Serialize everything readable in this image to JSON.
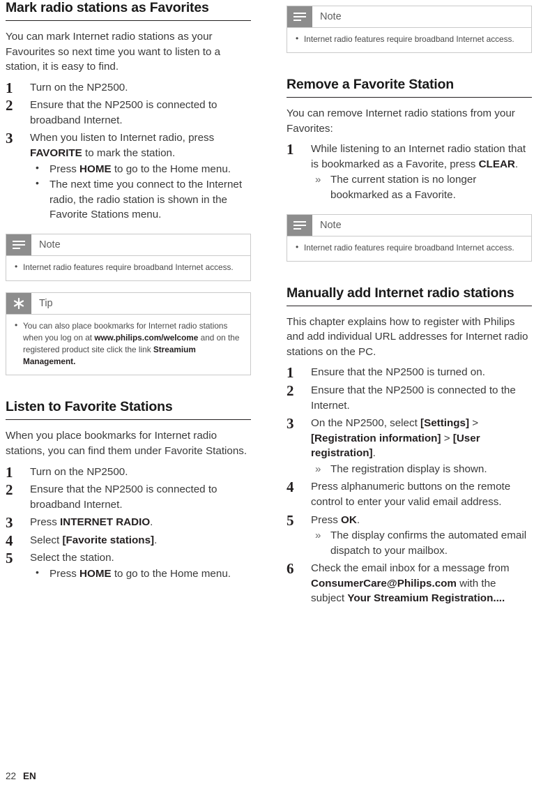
{
  "page": {
    "number": "22",
    "language": "EN"
  },
  "left": {
    "section1": {
      "title": "Mark radio stations as Favorites",
      "intro": "You can mark Internet radio stations as your Favourites so next time you want to listen to a station, it is easy to find.",
      "steps": [
        {
          "num": "1",
          "text": "Turn on the NP2500."
        },
        {
          "num": "2",
          "text": "Ensure that the NP2500 is connected to broadband Internet."
        },
        {
          "num": "3",
          "html": "When you listen to Internet radio, press <b>FAVORITE</b> to mark the station."
        }
      ],
      "step3_bullets": [
        {
          "html": "Press <b>HOME</b> to go to the Home menu."
        },
        {
          "html": "The next time you connect to the Internet radio, the radio station is shown in the Favorite Stations menu."
        }
      ]
    },
    "note1": {
      "label": "Note",
      "icon": "note-lines-icon",
      "items": [
        {
          "html": "Internet radio features require broadband Internet access."
        }
      ]
    },
    "tip1": {
      "label": "Tip",
      "icon": "tip-asterisk-icon",
      "items": [
        {
          "html": "You can also place bookmarks for Internet radio stations when you log on at <b>www.philips.com/welcome</b> and on the registered product site click the link <b>Streamium Management.</b>"
        }
      ]
    },
    "section2": {
      "title": "Listen to Favorite Stations",
      "intro": "When you place bookmarks for Internet radio stations, you can find them under Favorite Stations.",
      "steps": [
        {
          "num": "1",
          "text": "Turn on the NP2500."
        },
        {
          "num": "2",
          "text": "Ensure that the NP2500 is connected to broadband Internet."
        },
        {
          "num": "3",
          "html": "Press <b>INTERNET RADIO</b>."
        },
        {
          "num": "4",
          "html": "Select <b>[Favorite stations]</b>."
        },
        {
          "num": "5",
          "text": "Select the station."
        }
      ],
      "step5_bullets": [
        {
          "html": "Press <b>HOME</b> to go to the Home menu."
        }
      ]
    }
  },
  "right": {
    "note1": {
      "label": "Note",
      "icon": "note-lines-icon",
      "items": [
        {
          "html": "Internet radio features require broadband Internet access."
        }
      ]
    },
    "section1": {
      "title": "Remove a Favorite Station",
      "intro": "You can remove Internet radio stations from your Favorites:",
      "steps": [
        {
          "num": "1",
          "html": "While listening to an Internet radio station that is bookmarked as a Favorite, press <b>CLEAR</b>."
        }
      ],
      "step1_arrows": [
        {
          "html": "The current station is no longer bookmarked as a Favorite."
        }
      ]
    },
    "note2": {
      "label": "Note",
      "icon": "note-lines-icon",
      "items": [
        {
          "html": "Internet radio features require broadband Internet access."
        }
      ]
    },
    "section2": {
      "title": "Manually add Internet radio stations",
      "intro": "This chapter explains how to register with Philips and add individual URL addresses for Internet radio stations on the PC.",
      "steps": [
        {
          "num": "1",
          "text": "Ensure that the NP2500 is turned on."
        },
        {
          "num": "2",
          "text": "Ensure that the NP2500 is connected to the Internet."
        },
        {
          "num": "3",
          "html": "On the NP2500, select <b>[Settings]</b> &gt; <b>[Registration information]</b> &gt; <b>[User registration]</b>."
        },
        {
          "num": "4",
          "text": "Press alphanumeric buttons on the remote control to enter your valid email address."
        },
        {
          "num": "5",
          "html": "Press <b>OK</b>."
        },
        {
          "num": "6",
          "html": "Check the email inbox for a message from <b>ConsumerCare@Philips.com</b> with the subject <b>Your Streamium Registration....</b>"
        }
      ],
      "step3_arrows": [
        {
          "html": "The registration display is shown."
        }
      ],
      "step5_arrows": [
        {
          "html": "The display confirms the automated email dispatch to your mailbox."
        }
      ]
    }
  }
}
